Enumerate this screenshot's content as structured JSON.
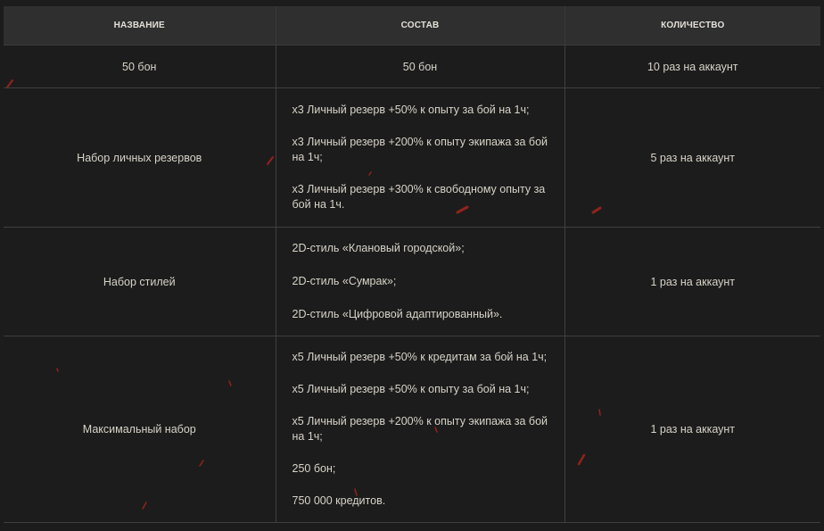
{
  "table": {
    "headers": [
      "НАЗВАНИЕ",
      "СОСТАВ",
      "КОЛИЧЕСТВО"
    ],
    "rows": [
      {
        "name": "50 бон",
        "contents": [
          "50 бон"
        ],
        "quantity": "10 раз на аккаунт"
      },
      {
        "name": "Набор личных резервов",
        "contents": [
          "x3 Личный резерв +50% к опыту за бой на 1ч;",
          "x3 Личный резерв +200% к опыту экипажа за бой на 1ч;",
          "x3 Личный резерв +300% к свободному опыту за бой на 1ч."
        ],
        "quantity": "5 раз на аккаунт"
      },
      {
        "name": "Набор стилей",
        "contents": [
          "2D-стиль «Клановый городской»;",
          "2D-стиль «Сумрак»;",
          "2D-стиль «Цифровой адаптированный»."
        ],
        "quantity": "1 раз на аккаунт"
      },
      {
        "name": "Максимальный набор",
        "contents": [
          "x5 Личный резерв +50% к кредитам за бой на 1ч;",
          "x5 Личный резерв +50% к опыту за бой на 1ч;",
          "x5 Личный резерв +200% к опыту экипажа за бой на 1ч;",
          "250 бон;",
          "750 000 кредитов."
        ],
        "quantity": "1 раз на аккаунт"
      }
    ]
  },
  "colors": {
    "background": "#1c1c1c",
    "header_background": "#2f2f2f",
    "text": "#d6d3c8",
    "border": "#3f3f3f",
    "spark": "#b3261e"
  }
}
